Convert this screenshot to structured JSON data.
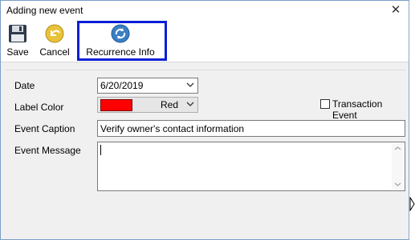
{
  "window": {
    "title": "Adding new event"
  },
  "toolbar": {
    "save_label": "Save",
    "cancel_label": "Cancel",
    "recurrence_label": "Recurrence Info"
  },
  "form": {
    "date_label": "Date",
    "date_value": "6/20/2019",
    "label_color_label": "Label Color",
    "label_color_value": "Red",
    "label_color_hex": "#ff0000",
    "transaction_label": "Transaction Event",
    "transaction_checked": false,
    "caption_label": "Event Caption",
    "caption_value": "Verify owner's contact information",
    "message_label": "Event Message",
    "message_value": ""
  },
  "icons": {
    "save": "floppy-disk-icon",
    "cancel": "undo-arrow-icon",
    "recurrence": "recurrence-icon",
    "close": "close-icon"
  }
}
